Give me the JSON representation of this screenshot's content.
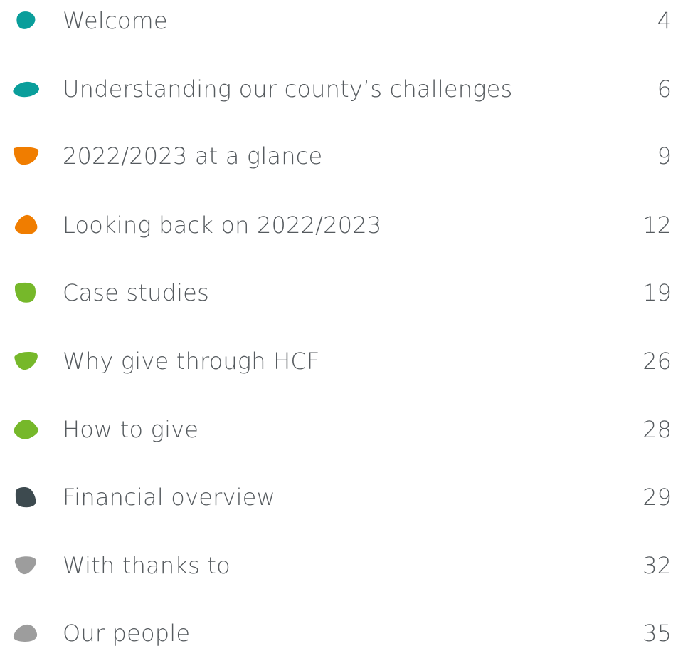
{
  "toc": {
    "items": [
      {
        "label": "Welcome",
        "page": "4",
        "color": "#0a9e9b",
        "icon": "teal-pebble-icon"
      },
      {
        "label": "Understanding our county’s challenges",
        "page": "6",
        "color": "#0a9e9b",
        "icon": "teal-pebble-icon"
      },
      {
        "label": "2022/2023 at a glance",
        "page": "9",
        "color": "#f07d00",
        "icon": "orange-pebble-icon"
      },
      {
        "label": "Looking back on 2022/2023",
        "page": "12",
        "color": "#f07d00",
        "icon": "orange-pebble-icon"
      },
      {
        "label": "Case studies",
        "page": "19",
        "color": "#76b82a",
        "icon": "green-pebble-icon"
      },
      {
        "label": "Why give through HCF",
        "page": "26",
        "color": "#76b82a",
        "icon": "green-pebble-icon"
      },
      {
        "label": "How to give",
        "page": "28",
        "color": "#76b82a",
        "icon": "green-pebble-icon"
      },
      {
        "label": "Financial overview",
        "page": "29",
        "color": "#3d4a4f",
        "icon": "dark-grey-pebble-icon"
      },
      {
        "label": "With thanks to",
        "page": "32",
        "color": "#9d9d9d",
        "icon": "grey-pebble-icon"
      },
      {
        "label": "Our people",
        "page": "35",
        "color": "#9d9d9d",
        "icon": "grey-pebble-icon"
      }
    ]
  }
}
